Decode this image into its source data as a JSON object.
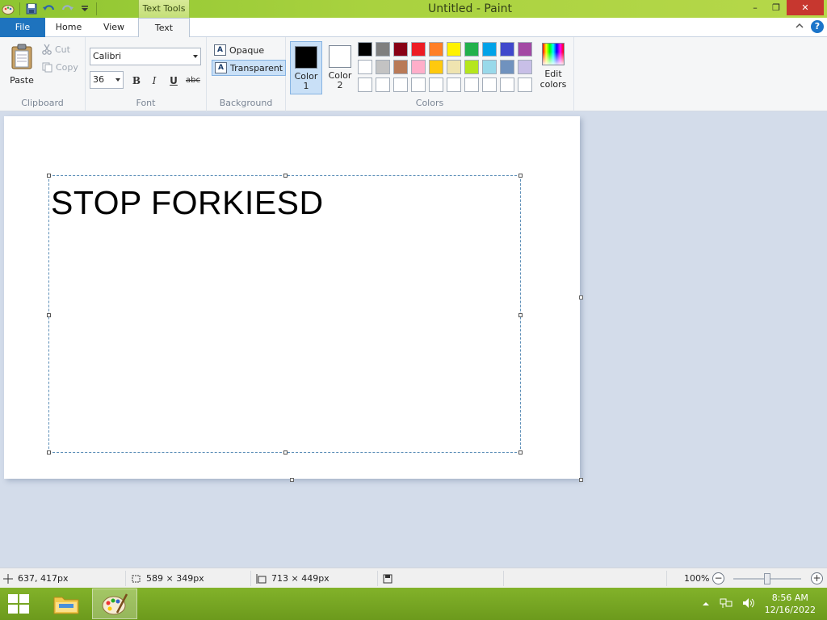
{
  "window": {
    "title": "Untitled - Paint",
    "context_tab_label": "Text Tools",
    "controls": {
      "minimize": "–",
      "restore": "❐",
      "close": "✕"
    }
  },
  "tabs": {
    "file": "File",
    "home": "Home",
    "view": "View",
    "text": "Text"
  },
  "ribbon": {
    "clipboard": {
      "paste": "Paste",
      "cut": "Cut",
      "copy": "Copy",
      "group": "Clipboard"
    },
    "font": {
      "family": "Calibri",
      "size": "36",
      "bold": "B",
      "italic": "I",
      "underline": "U",
      "strikethrough": "abc",
      "group": "Font"
    },
    "background": {
      "opaque": "Opaque",
      "transparent": "Transparent",
      "group": "Background",
      "selected": "Transparent"
    },
    "colors": {
      "color1_label_line1": "Color",
      "color1_label_line2": "1",
      "color2_label_line1": "Color",
      "color2_label_line2": "2",
      "color1": "#000000",
      "color2": "#ffffff",
      "edit_colors_line1": "Edit",
      "edit_colors_line2": "colors",
      "group": "Colors",
      "palette": [
        "#000000",
        "#7f7f7f",
        "#880015",
        "#ed1c24",
        "#ff7f27",
        "#fff200",
        "#22b14c",
        "#00a2e8",
        "#3f48cc",
        "#a349a4",
        "#ffffff",
        "#c3c3c3",
        "#b97a57",
        "#ffaec9",
        "#ffc90e",
        "#efe4b0",
        "#b5e61d",
        "#99d9ea",
        "#7092be",
        "#c8bfe7",
        "#ffffff",
        "#ffffff",
        "#ffffff",
        "#ffffff",
        "#ffffff",
        "#ffffff",
        "#ffffff",
        "#ffffff",
        "#ffffff",
        "#ffffff"
      ]
    }
  },
  "canvas": {
    "text": "STOP FORKIESD"
  },
  "status": {
    "cursor_pos": "637, 417px",
    "selection_size": "589 × 349px",
    "image_size": "713 × 449px",
    "zoom": "100%",
    "zoom_out": "−",
    "zoom_in": "+"
  },
  "taskbar": {
    "time": "8:56 AM",
    "date": "12/16/2022"
  }
}
